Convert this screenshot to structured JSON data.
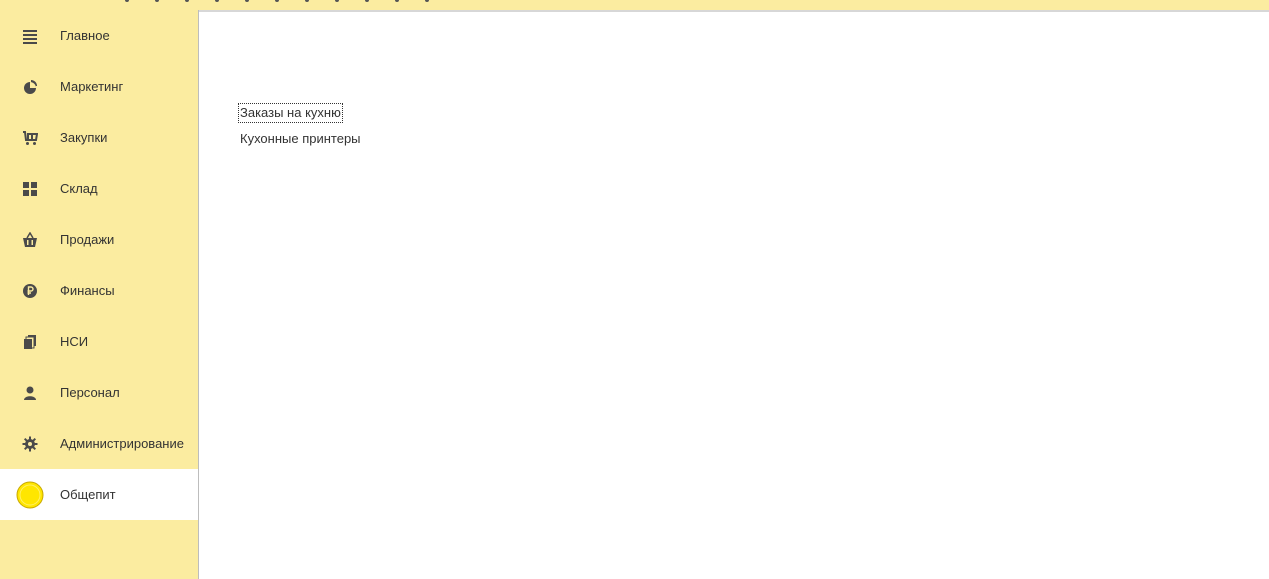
{
  "sidebar": {
    "items": [
      {
        "label": "Главное",
        "icon": "menu-lines-icon"
      },
      {
        "label": "Маркетинг",
        "icon": "pie-chart-icon"
      },
      {
        "label": "Закупки",
        "icon": "cart-icon"
      },
      {
        "label": "Склад",
        "icon": "grid-icon"
      },
      {
        "label": "Продажи",
        "icon": "basket-icon"
      },
      {
        "label": "Финансы",
        "icon": "ruble-icon"
      },
      {
        "label": "НСИ",
        "icon": "documents-icon"
      },
      {
        "label": "Персонал",
        "icon": "person-icon"
      },
      {
        "label": "Администрирование",
        "icon": "gear-icon"
      },
      {
        "label": "Общепит",
        "icon": "yellow-circle-icon",
        "active": true
      }
    ]
  },
  "content": {
    "links": [
      {
        "label": "Заказы на кухню",
        "focused": true
      },
      {
        "label": "Кухонные принтеры",
        "focused": false
      }
    ]
  },
  "colors": {
    "sidebar_bg": "#fbeca0",
    "active_bg": "#ffffff",
    "icon": "#4a4a4a",
    "accent_circle": "#ffe600"
  }
}
